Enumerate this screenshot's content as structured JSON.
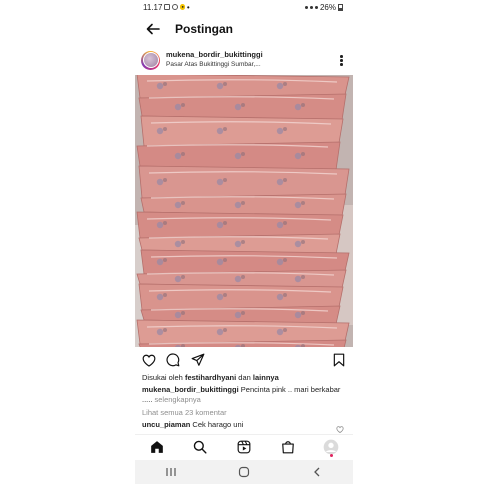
{
  "status_bar": {
    "time": "11.17",
    "battery": "26%",
    "dot": "•"
  },
  "header": {
    "title": "Postingan",
    "back_icon": "arrow-left-icon"
  },
  "post": {
    "username": "mukena_bordir_bukittinggi",
    "location": "Pasar Atas Bukittinggi Sumbar,...",
    "likes": {
      "prefix": "Disukai oleh ",
      "user": "festihardhyani",
      "connector": " dan ",
      "others": "lainnya"
    },
    "caption": {
      "user": "mukena_bordir_bukittinggi",
      "text": " Pencinta pink .. mari berkabar .....",
      "more": " selengkapnya"
    },
    "view_comments": "Lihat semua 23 komentar",
    "top_comment": {
      "user": "uncu_piaman",
      "text": " Cek harago uni"
    }
  },
  "actions": [
    "heart-icon",
    "comment-icon",
    "share-icon",
    "bookmark-icon"
  ],
  "tabs": [
    "home-icon",
    "search-icon",
    "reels-icon",
    "shop-icon",
    "profile-icon"
  ],
  "system_nav": [
    "recents-icon",
    "home-circle-icon",
    "back-chevron-icon"
  ],
  "colors": {
    "accent_pink": "#d9968f",
    "notification_dot": "#e0245e",
    "text": "#262626",
    "muted": "#8e8e8e"
  }
}
